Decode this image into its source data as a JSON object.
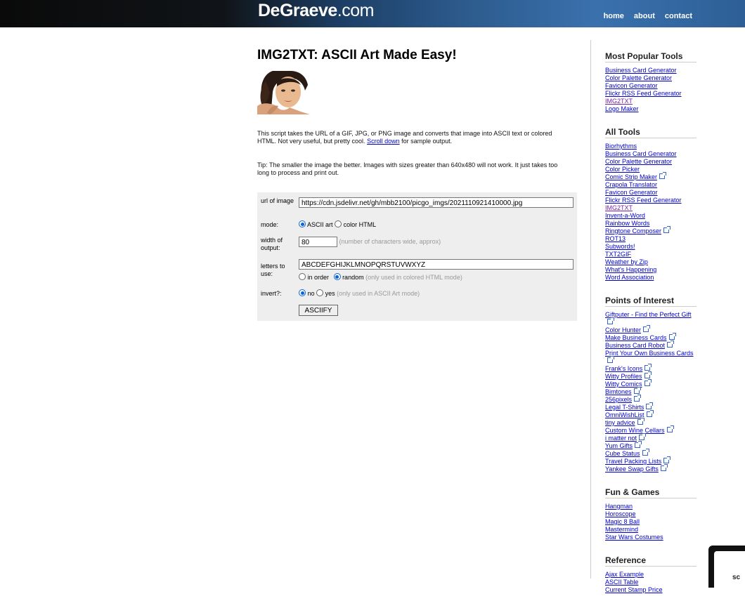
{
  "header": {
    "logo_main": "DeGraeve",
    "logo_tld": ".com",
    "nav": [
      "home",
      "about",
      "contact"
    ]
  },
  "main": {
    "title": "IMG2TXT: ASCII Art Made Easy!",
    "intro_before": "This script takes the URL of a GIF, JPG, or PNG image and converts that image into ASCII text or colored HTML. Not very useful, but pretty cool. ",
    "intro_link": "Scroll down",
    "intro_after": " for sample output.",
    "tip": "Tip: The smaller the image the better. Images with sizes greater than 640x480 will not work. It just takes too long to process and print out."
  },
  "form": {
    "url_label": "url of image",
    "url_value": "https://cdn.jsdelivr.net/gh/mbb2100/picgo_imgs/2021110921410000.jpg",
    "mode_label": "mode:",
    "mode_ascii": "ASCII art",
    "mode_color": "color HTML",
    "width_label": "width of output:",
    "width_value": "80",
    "width_hint": "(number of characters wide, approx)",
    "letters_label": "letters to use:",
    "letters_value": "ABCDEFGHIJKLMNOPQRSTUVWXYZ",
    "order_in": "in order",
    "order_random": "random",
    "order_hint": "(only used in colored HTML mode)",
    "invert_label": "invert?:",
    "invert_no": "no",
    "invert_yes": "yes",
    "invert_hint": "(only used in ASCII Art mode)",
    "submit": "ASCIIFY"
  },
  "sidebar": {
    "sections": [
      {
        "title": "Most Popular Tools",
        "items": [
          {
            "label": "Business Card Generator"
          },
          {
            "label": "Color Palette Generator"
          },
          {
            "label": "Favicon Generator"
          },
          {
            "label": "Flickr RSS Feed Generator"
          },
          {
            "label": "IMG2TXT",
            "current": true
          },
          {
            "label": "Logo Maker"
          }
        ]
      },
      {
        "title": "All Tools",
        "items": [
          {
            "label": "Biorhythms"
          },
          {
            "label": "Business Card Generator"
          },
          {
            "label": "Color Palette Generator"
          },
          {
            "label": "Color Picker"
          },
          {
            "label": "Comic Strip Maker",
            "ext": true
          },
          {
            "label": "Crapola Translator"
          },
          {
            "label": "Favicon Generator"
          },
          {
            "label": "Flickr RSS Feed Generator"
          },
          {
            "label": "IMG2TXT",
            "current": true
          },
          {
            "label": "Invent-a-Word"
          },
          {
            "label": "Rainbow Words"
          },
          {
            "label": "Ringtone Composer",
            "ext": true
          },
          {
            "label": "ROT13"
          },
          {
            "label": "Subwords!"
          },
          {
            "label": "TXT2GIF"
          },
          {
            "label": "Weather by Zip"
          },
          {
            "label": "What's Happening"
          },
          {
            "label": "Word Association"
          }
        ]
      },
      {
        "title": "Points of Interest",
        "items": [
          {
            "label": "Giftputer - Find the Perfect Gift",
            "ext": true
          },
          {
            "label": "Color Hunter",
            "ext": true
          },
          {
            "label": "Make Business Cards",
            "ext": true
          },
          {
            "label": "Business Card Robot",
            "ext": true
          },
          {
            "label": "Print Your Own Business Cards",
            "ext": true
          },
          {
            "label": "Frank's Icons",
            "ext": true
          },
          {
            "label": "Witty Profiles",
            "ext": true
          },
          {
            "label": "Witty Comics",
            "ext": true
          },
          {
            "label": "Bimtones",
            "ext": true
          },
          {
            "label": "256pixels",
            "ext": true
          },
          {
            "label": "Legal T-Shirts",
            "ext": true
          },
          {
            "label": "OmniWishList",
            "ext": true
          },
          {
            "label": "tiny advice",
            "ext": true
          },
          {
            "label": "Custom Wine Cellars",
            "ext": true
          },
          {
            "label": "i matter not",
            "ext": true
          },
          {
            "label": "Yum Gifts",
            "ext": true
          },
          {
            "label": "Cube Status",
            "ext": true
          },
          {
            "label": "Travel Packing Lists",
            "ext": true
          },
          {
            "label": "Yankee Swap Gifts",
            "ext": true
          }
        ]
      },
      {
        "title": "Fun & Games",
        "items": [
          {
            "label": "Hangman"
          },
          {
            "label": "Horoscope"
          },
          {
            "label": "Magic 8 Ball"
          },
          {
            "label": "Mastermind"
          },
          {
            "label": "Star Wars Costumes"
          }
        ]
      },
      {
        "title": "Reference",
        "items": [
          {
            "label": "Ajax Example"
          },
          {
            "label": "ASCII Table"
          },
          {
            "label": "Current Stamp Price"
          }
        ]
      }
    ]
  },
  "corner_badge": {
    "text": "sc"
  }
}
